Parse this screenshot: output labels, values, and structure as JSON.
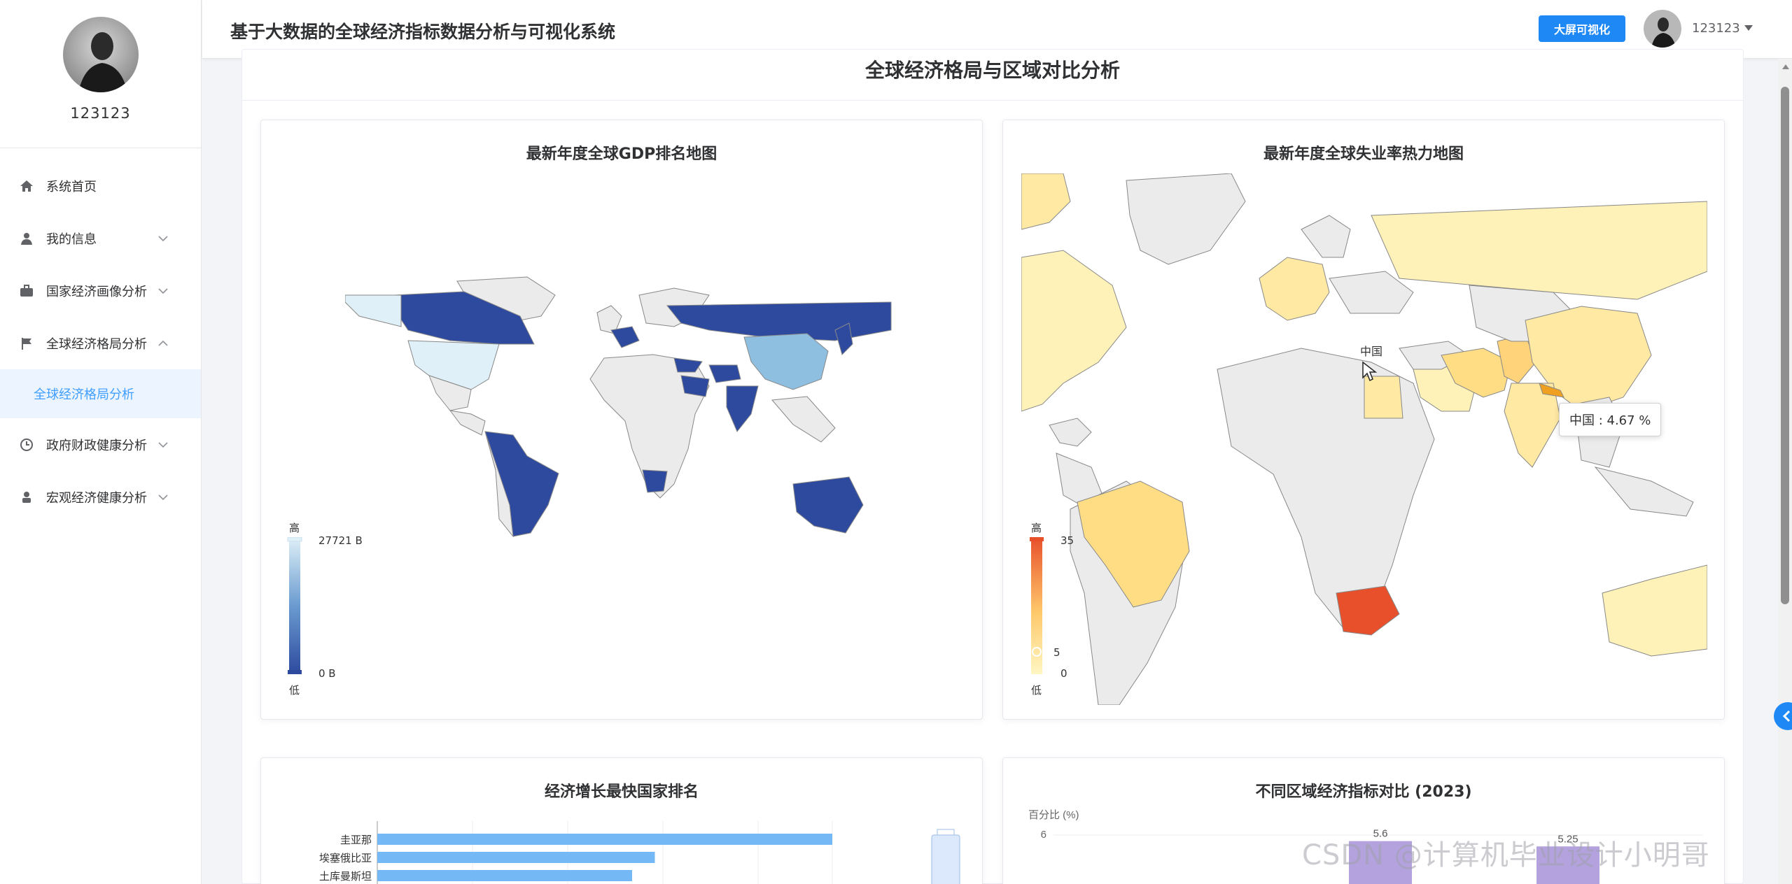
{
  "user": {
    "name": "123123"
  },
  "header": {
    "title": "基于大数据的全球经济指标数据分析与可视化系统",
    "big_screen_label": "大屏可视化",
    "username": "123123"
  },
  "sidebar": {
    "items": [
      {
        "label": "系统首页",
        "icon": "home-icon"
      },
      {
        "label": "我的信息",
        "icon": "user-icon"
      },
      {
        "label": "国家经济画像分析",
        "icon": "briefcase-icon"
      },
      {
        "label": "全球经济格局分析",
        "icon": "flag-icon"
      },
      {
        "label": "政府财政健康分析",
        "icon": "clock-icon"
      },
      {
        "label": "宏观经济健康分析",
        "icon": "person-icon"
      }
    ],
    "active_sub": "全球经济格局分析"
  },
  "main": {
    "section_title": "全球经济格局与区域对比分析",
    "gdp_map": {
      "title": "最新年度全球GDP排名地图",
      "legend_high": "高",
      "legend_low": "低",
      "legend_max": "27721 B",
      "legend_min": "0 B"
    },
    "unemployment_map": {
      "title": "最新年度全球失业率热力地图",
      "legend_high": "高",
      "legend_low": "低",
      "legend_max": "35",
      "legend_5": "5",
      "legend_0": "0",
      "label_china": "中国",
      "tooltip": "中国 : 4.67 %"
    },
    "growth_chart": {
      "title": "经济增长最快国家排名"
    },
    "region_chart": {
      "title": "不同区域经济指标对比 (2023)"
    }
  },
  "chart_data": [
    {
      "type": "bar",
      "title": "经济增长最快国家排名",
      "categories": [
        "圭亚那",
        "埃塞俄比亚",
        "土库曼斯坦"
      ],
      "values": [
        100,
        61,
        56
      ]
    },
    {
      "type": "bar",
      "title": "不同区域经济指标对比 (2023)",
      "ylabel": "百分比 (%)",
      "ytick_top": "6",
      "categories": [
        "",
        ""
      ],
      "values": [
        5.6,
        5.25
      ],
      "value_labels": [
        "5.6",
        "5.25"
      ],
      "ylim": [
        0,
        6
      ]
    }
  ],
  "watermark": "CSDN @计算机毕业设计小明哥",
  "colors": {
    "accent": "#409eff",
    "button": "#1e88f5",
    "gdp_high": "#2e4a9e",
    "gdp_low": "#dff0f8",
    "unemp_high": "#e8502c",
    "unemp_low": "#fff6c2"
  }
}
